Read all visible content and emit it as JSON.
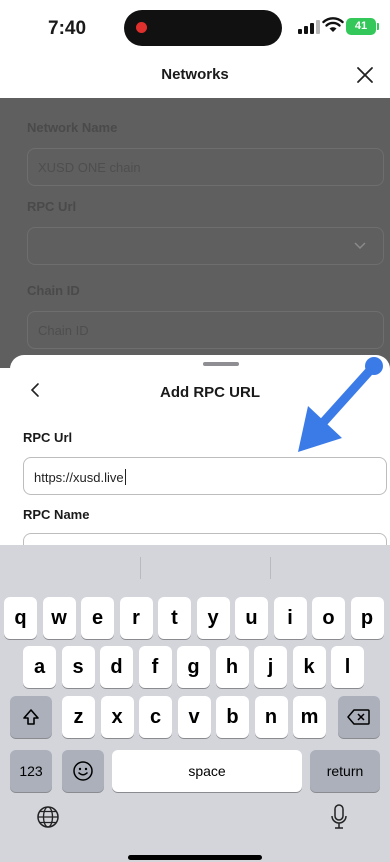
{
  "status": {
    "time": "7:40",
    "battery": "41"
  },
  "header": {
    "title": "Networks"
  },
  "background_form": {
    "network_name_label": "Network Name",
    "network_name_value": "XUSD ONE chain",
    "rpc_url_label": "RPC Url",
    "chain_id_label": "Chain ID",
    "chain_id_placeholder": "Chain ID"
  },
  "sheet": {
    "title": "Add RPC URL",
    "rpc_url_label": "RPC Url",
    "rpc_url_value": "https://xusd.live",
    "rpc_name_label": "RPC Name"
  },
  "keyboard": {
    "row1": [
      "q",
      "w",
      "e",
      "r",
      "t",
      "y",
      "u",
      "i",
      "o",
      "p"
    ],
    "row2": [
      "a",
      "s",
      "d",
      "f",
      "g",
      "h",
      "j",
      "k",
      "l"
    ],
    "row3": [
      "z",
      "x",
      "c",
      "v",
      "b",
      "n",
      "m"
    ],
    "numbers_key": "123",
    "space_key": "space",
    "return_key": "return"
  },
  "colors": {
    "accent_arrow": "#3b7be8",
    "battery": "#34c759",
    "dim_overlay": "#5f5f5f"
  },
  "icons": [
    "close-icon",
    "chevron-down-icon",
    "back-chevron-icon",
    "shift-icon",
    "delete-icon",
    "emoji-icon",
    "globe-icon",
    "microphone-icon"
  ]
}
